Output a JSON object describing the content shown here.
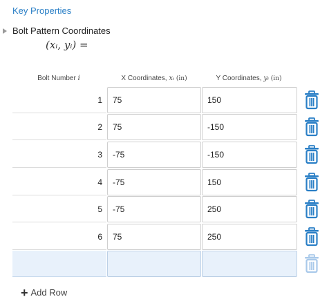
{
  "header": {
    "title": "Key Properties"
  },
  "section": {
    "title": "Bolt Pattern Coordinates",
    "formula": "(xᵢ, yᵢ) ="
  },
  "table": {
    "col1": {
      "text": "Bolt Number ",
      "var": "i"
    },
    "col2": {
      "text": "X Coordinates, ",
      "var": "xᵢ",
      "unit": " (in)"
    },
    "col3": {
      "text": "Y Coordinates, ",
      "var": "yᵢ",
      "unit": " (in)"
    },
    "rows": [
      {
        "num": "1",
        "x": "75",
        "y": "150"
      },
      {
        "num": "2",
        "x": "75",
        "y": "-150"
      },
      {
        "num": "3",
        "x": "-75",
        "y": "-150"
      },
      {
        "num": "4",
        "x": "-75",
        "y": "150"
      },
      {
        "num": "5",
        "x": "-75",
        "y": "250"
      },
      {
        "num": "6",
        "x": "75",
        "y": "250"
      }
    ]
  },
  "add_row_label": "Add Row",
  "colors": {
    "accent": "#2a7fc6",
    "empty_row": "#e8f1fb",
    "trash_disabled": "#a9c9ea"
  }
}
